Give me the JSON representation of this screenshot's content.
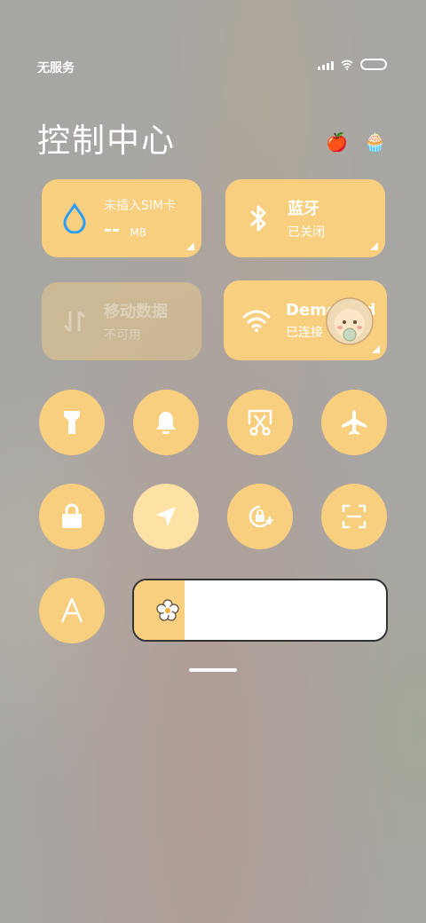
{
  "status_bar": {
    "carrier": "无服务"
  },
  "header": {
    "title": "控制中心",
    "emoji_1": "🍎",
    "emoji_2": "🧁"
  },
  "tiles": {
    "data_usage": {
      "title": "未插入SIM卡",
      "value": "--",
      "unit": "MB"
    },
    "bluetooth": {
      "title": "蓝牙",
      "status": "已关闭"
    },
    "mobile_data": {
      "title": "移动数据",
      "status": "不可用"
    },
    "wifi": {
      "title": "DemoMod",
      "status": "已连接"
    }
  },
  "toggles": [
    "flashlight-icon",
    "bell-icon",
    "screenshot-icon",
    "airplane-icon",
    "lock-icon",
    "location-icon",
    "rotation-lock-icon",
    "scan-icon",
    "font-icon"
  ],
  "brightness": {
    "level": 0.2
  },
  "colors": {
    "accent": "#f8ce7f",
    "accent_active": "#fde1a5",
    "droplet": "#2a9df4"
  }
}
